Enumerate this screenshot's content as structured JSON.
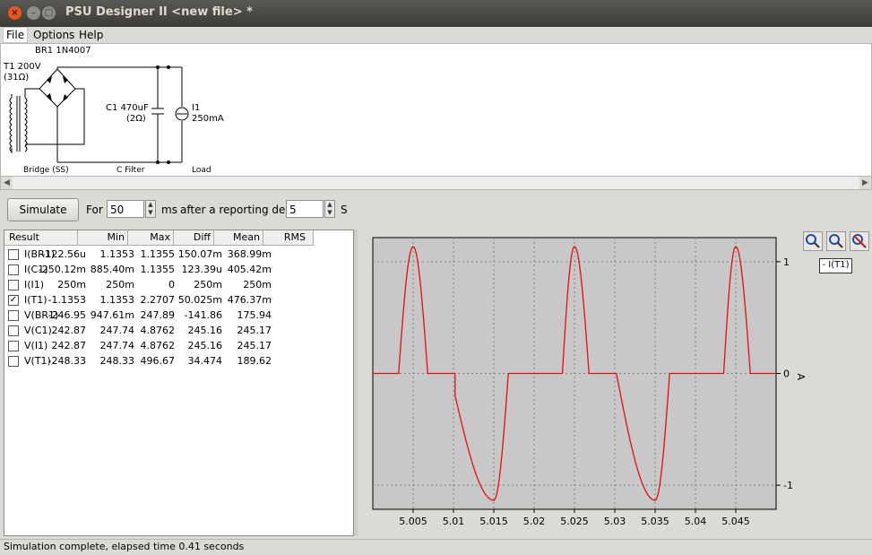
{
  "window": {
    "title": "PSU Designer II  <new file> *"
  },
  "menu": {
    "items": [
      "File",
      "Options",
      "Help"
    ]
  },
  "schematic": {
    "bridge_label": "BR1 1N4007",
    "t1_label": "T1 200V",
    "t1_res": "(31Ω)",
    "c1_label": "C1 470uF",
    "c1_res": "(2Ω)",
    "i1_label": "I1",
    "i1_value": "250mA",
    "section_bridge": "Bridge (SS)",
    "section_filter": "C Filter",
    "section_load": "Load"
  },
  "toolbar": {
    "simulate_label": "Simulate",
    "for_label": "For",
    "duration_value": "50",
    "ms_label": "ms",
    "delay_label": "after a reporting delay of",
    "delay_value": "5",
    "s_label": "S"
  },
  "table": {
    "headers": [
      "Result",
      "Min",
      "Max",
      "Diff",
      "Mean",
      "RMS"
    ],
    "rows": [
      {
        "checked": false,
        "name": "I(BR1)",
        "min": "-122.56u",
        "max": "1.1353",
        "diff": "1.1355",
        "mean": "150.07m",
        "rms": "368.99m"
      },
      {
        "checked": false,
        "name": "I(C1)",
        "min": "-250.12m",
        "max": "885.40m",
        "diff": "1.1355",
        "mean": "123.39u",
        "rms": "405.42m"
      },
      {
        "checked": false,
        "name": "I(I1)",
        "min": "250m",
        "max": "250m",
        "diff": "0",
        "mean": "250m",
        "rms": "250m"
      },
      {
        "checked": true,
        "name": "I(T1)",
        "min": "-1.1353",
        "max": "1.1353",
        "diff": "2.2707",
        "mean": "50.025m",
        "rms": "476.37m"
      },
      {
        "checked": false,
        "name": "V(BR1)",
        "min": "-246.95",
        "max": "947.61m",
        "diff": "247.89",
        "mean": "-141.86",
        "rms": "175.94"
      },
      {
        "checked": false,
        "name": "V(C1)",
        "min": "242.87",
        "max": "247.74",
        "diff": "4.8762",
        "mean": "245.16",
        "rms": "245.17"
      },
      {
        "checked": false,
        "name": "V(I1)",
        "min": "242.87",
        "max": "247.74",
        "diff": "4.8762",
        "mean": "245.16",
        "rms": "245.17"
      },
      {
        "checked": false,
        "name": "V(T1)",
        "min": "-248.33",
        "max": "248.33",
        "diff": "496.67",
        "mean": "34.474",
        "rms": "189.62"
      }
    ]
  },
  "zoom": {
    "icons": [
      "zoom-in-icon",
      "zoom-fit-icon",
      "zoom-out-icon"
    ]
  },
  "chart_data": {
    "type": "line",
    "xlim": [
      5.0,
      5.05
    ],
    "ylim": [
      -1.1353,
      1.1353
    ],
    "x_ticks": [
      "5.005",
      "5.01",
      "5.015",
      "5.02",
      "5.025",
      "5.03",
      "5.035",
      "5.04",
      "5.045"
    ],
    "y_ticks": [
      "1",
      "0",
      "-1"
    ],
    "ylabel": "A",
    "grid": true,
    "legend": "- I(T1)",
    "series": [
      {
        "name": "I(T1)",
        "color": "#e01010",
        "points": [
          [
            5.0,
            0
          ],
          [
            5.0032,
            0
          ],
          [
            5.005,
            1.1353
          ],
          [
            5.0068,
            0
          ],
          [
            5.0102,
            0
          ],
          [
            5.0102,
            -0.2
          ],
          [
            5.015,
            -1.1353
          ],
          [
            5.0168,
            0
          ],
          [
            5.0235,
            0
          ],
          [
            5.025,
            1.1353
          ],
          [
            5.0268,
            0
          ],
          [
            5.0302,
            0
          ],
          [
            5.035,
            -1.1353
          ],
          [
            5.0368,
            0
          ],
          [
            5.0435,
            0
          ],
          [
            5.045,
            1.1353
          ],
          [
            5.0468,
            0
          ],
          [
            5.05,
            0
          ]
        ]
      }
    ]
  },
  "status": {
    "text": "Simulation complete, elapsed time 0.41 seconds"
  }
}
